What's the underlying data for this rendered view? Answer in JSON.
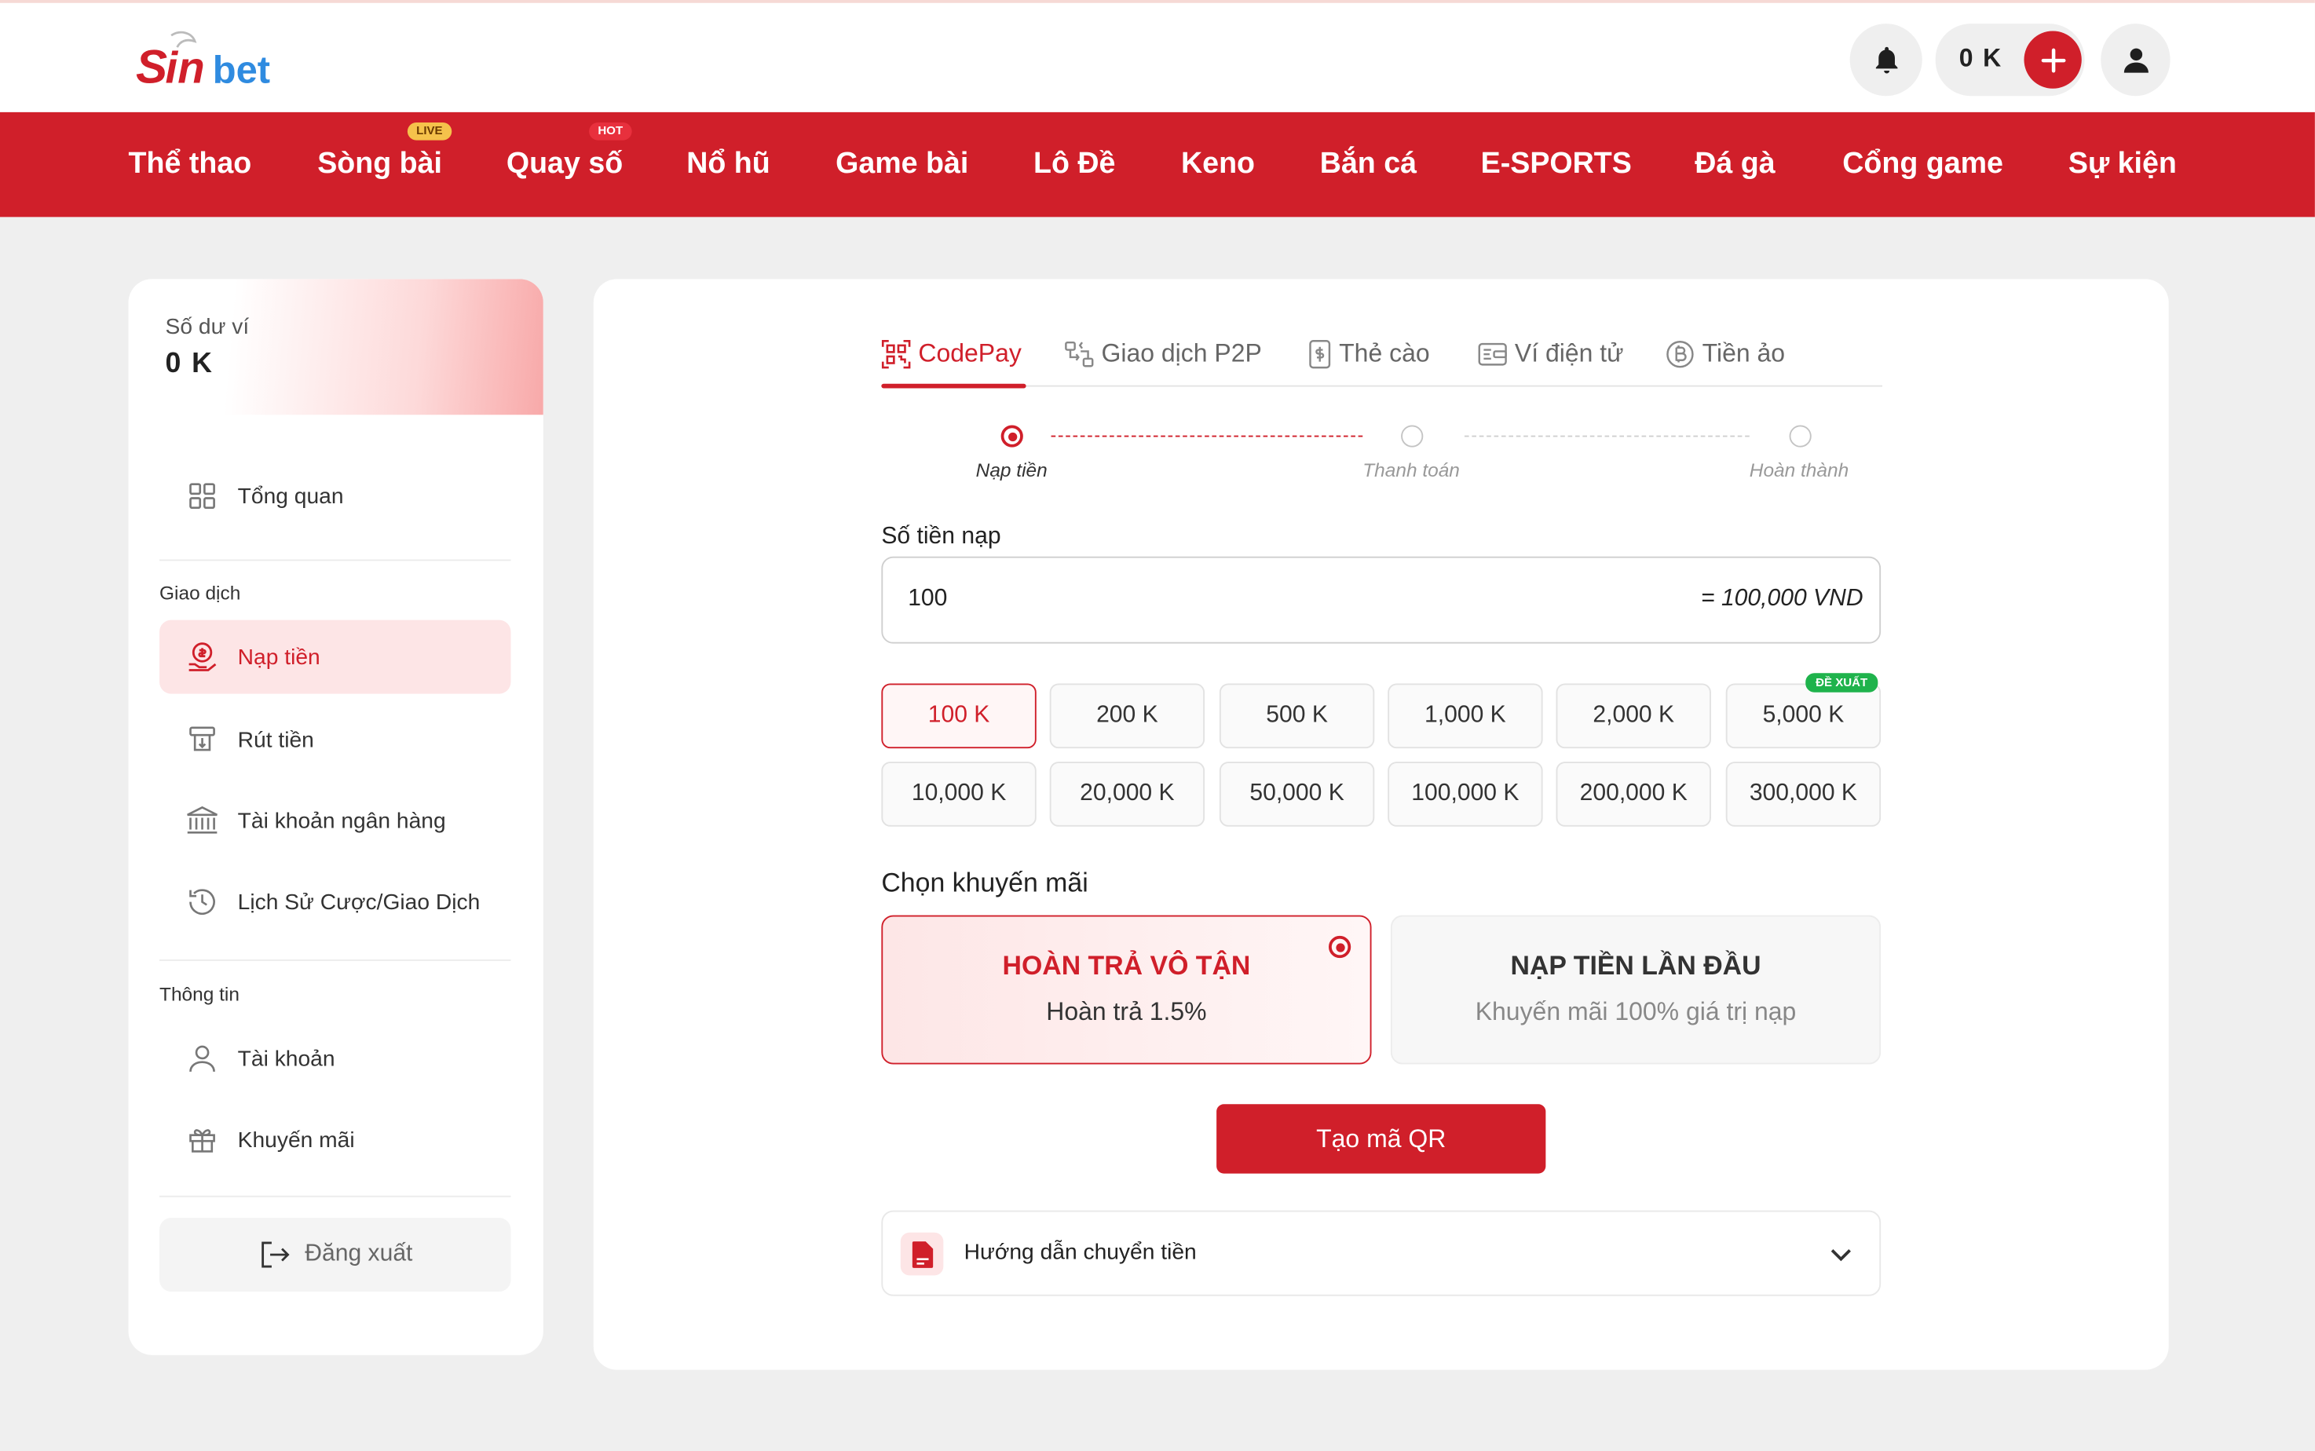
{
  "brand": {
    "logo_text": "Sinbet",
    "primary_color": "#d01f2a",
    "accent_blue": "#2f8be0"
  },
  "header": {
    "balance": "0 K",
    "icons": [
      "bell-icon",
      "plus-icon",
      "user-icon"
    ]
  },
  "nav": {
    "items": [
      {
        "label": "Thể thao"
      },
      {
        "label": "Sòng bài",
        "badge": "LIVE"
      },
      {
        "label": "Quay số",
        "badge": "HOT"
      },
      {
        "label": "Nổ hũ"
      },
      {
        "label": "Game bài"
      },
      {
        "label": "Lô Đề"
      },
      {
        "label": "Keno"
      },
      {
        "label": "Bắn cá"
      },
      {
        "label": "E-SPORTS"
      },
      {
        "label": "Đá gà"
      },
      {
        "label": "Cổng game"
      },
      {
        "label": "Sự kiện"
      }
    ]
  },
  "sidebar": {
    "wallet_label": "Số dư ví",
    "wallet_value": "0 K",
    "overview": "Tổng quan",
    "section_transactions": "Giao dịch",
    "deposit": "Nạp tiền",
    "withdraw": "Rút tiền",
    "bank_account": "Tài khoản ngân hàng",
    "history": "Lịch Sử Cược/Giao Dịch",
    "section_info": "Thông tin",
    "account": "Tài khoản",
    "promotions": "Khuyến mãi",
    "logout": "Đăng xuất"
  },
  "main": {
    "tabs": [
      {
        "label": "CodePay",
        "active": true,
        "icon": "qr-scan-icon"
      },
      {
        "label": "Giao dịch P2P",
        "icon": "p2p-icon"
      },
      {
        "label": "Thẻ cào",
        "icon": "card-icon"
      },
      {
        "label": "Ví điện tử",
        "icon": "wallet-icon"
      },
      {
        "label": "Tiền ảo",
        "icon": "bitcoin-icon"
      }
    ],
    "steps": [
      "Nạp tiền",
      "Thanh toán",
      "Hoàn thành"
    ],
    "current_step": 0,
    "amount_label": "Số tiền nạp",
    "amount_value": "100",
    "amount_conversion": "= 100,000 VND",
    "chips": [
      "100 K",
      "200 K",
      "500 K",
      "1,000 K",
      "2,000 K",
      "5,000 K",
      "10,000 K",
      "20,000 K",
      "50,000 K",
      "100,000 K",
      "200,000 K",
      "300,000 K"
    ],
    "selected_chip": "100 K",
    "recommended_badge": "ĐỀ XUẤT",
    "promo_label": "Chọn khuyến mãi",
    "promos": [
      {
        "title": "HOÀN TRẢ VÔ TẬN",
        "subtitle": "Hoàn trả 1.5%",
        "selected": true
      },
      {
        "title": "NẠP TIỀN LẦN ĐẦU",
        "subtitle": "Khuyến mãi 100% giá trị nạp",
        "selected": false
      }
    ],
    "qr_button": "Tạo mã QR",
    "guide_label": "Hướng dẫn chuyển tiền"
  }
}
